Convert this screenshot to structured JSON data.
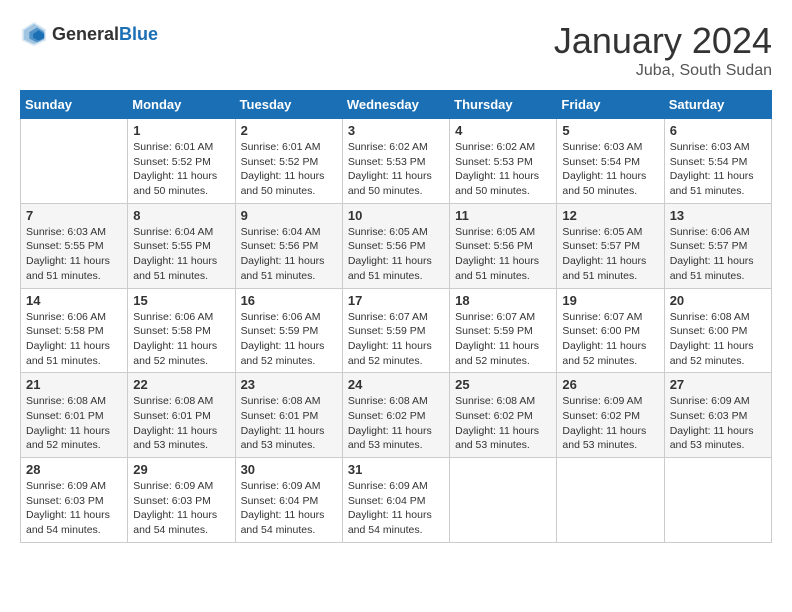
{
  "header": {
    "logo_general": "General",
    "logo_blue": "Blue",
    "month_title": "January 2024",
    "location": "Juba, South Sudan"
  },
  "days_of_week": [
    "Sunday",
    "Monday",
    "Tuesday",
    "Wednesday",
    "Thursday",
    "Friday",
    "Saturday"
  ],
  "weeks": [
    [
      {
        "day": "",
        "sunrise": "",
        "sunset": "",
        "daylight": ""
      },
      {
        "day": "1",
        "sunrise": "Sunrise: 6:01 AM",
        "sunset": "Sunset: 5:52 PM",
        "daylight": "Daylight: 11 hours and 50 minutes."
      },
      {
        "day": "2",
        "sunrise": "Sunrise: 6:01 AM",
        "sunset": "Sunset: 5:52 PM",
        "daylight": "Daylight: 11 hours and 50 minutes."
      },
      {
        "day": "3",
        "sunrise": "Sunrise: 6:02 AM",
        "sunset": "Sunset: 5:53 PM",
        "daylight": "Daylight: 11 hours and 50 minutes."
      },
      {
        "day": "4",
        "sunrise": "Sunrise: 6:02 AM",
        "sunset": "Sunset: 5:53 PM",
        "daylight": "Daylight: 11 hours and 50 minutes."
      },
      {
        "day": "5",
        "sunrise": "Sunrise: 6:03 AM",
        "sunset": "Sunset: 5:54 PM",
        "daylight": "Daylight: 11 hours and 50 minutes."
      },
      {
        "day": "6",
        "sunrise": "Sunrise: 6:03 AM",
        "sunset": "Sunset: 5:54 PM",
        "daylight": "Daylight: 11 hours and 51 minutes."
      }
    ],
    [
      {
        "day": "7",
        "sunrise": "Sunrise: 6:03 AM",
        "sunset": "Sunset: 5:55 PM",
        "daylight": "Daylight: 11 hours and 51 minutes."
      },
      {
        "day": "8",
        "sunrise": "Sunrise: 6:04 AM",
        "sunset": "Sunset: 5:55 PM",
        "daylight": "Daylight: 11 hours and 51 minutes."
      },
      {
        "day": "9",
        "sunrise": "Sunrise: 6:04 AM",
        "sunset": "Sunset: 5:56 PM",
        "daylight": "Daylight: 11 hours and 51 minutes."
      },
      {
        "day": "10",
        "sunrise": "Sunrise: 6:05 AM",
        "sunset": "Sunset: 5:56 PM",
        "daylight": "Daylight: 11 hours and 51 minutes."
      },
      {
        "day": "11",
        "sunrise": "Sunrise: 6:05 AM",
        "sunset": "Sunset: 5:56 PM",
        "daylight": "Daylight: 11 hours and 51 minutes."
      },
      {
        "day": "12",
        "sunrise": "Sunrise: 6:05 AM",
        "sunset": "Sunset: 5:57 PM",
        "daylight": "Daylight: 11 hours and 51 minutes."
      },
      {
        "day": "13",
        "sunrise": "Sunrise: 6:06 AM",
        "sunset": "Sunset: 5:57 PM",
        "daylight": "Daylight: 11 hours and 51 minutes."
      }
    ],
    [
      {
        "day": "14",
        "sunrise": "Sunrise: 6:06 AM",
        "sunset": "Sunset: 5:58 PM",
        "daylight": "Daylight: 11 hours and 51 minutes."
      },
      {
        "day": "15",
        "sunrise": "Sunrise: 6:06 AM",
        "sunset": "Sunset: 5:58 PM",
        "daylight": "Daylight: 11 hours and 52 minutes."
      },
      {
        "day": "16",
        "sunrise": "Sunrise: 6:06 AM",
        "sunset": "Sunset: 5:59 PM",
        "daylight": "Daylight: 11 hours and 52 minutes."
      },
      {
        "day": "17",
        "sunrise": "Sunrise: 6:07 AM",
        "sunset": "Sunset: 5:59 PM",
        "daylight": "Daylight: 11 hours and 52 minutes."
      },
      {
        "day": "18",
        "sunrise": "Sunrise: 6:07 AM",
        "sunset": "Sunset: 5:59 PM",
        "daylight": "Daylight: 11 hours and 52 minutes."
      },
      {
        "day": "19",
        "sunrise": "Sunrise: 6:07 AM",
        "sunset": "Sunset: 6:00 PM",
        "daylight": "Daylight: 11 hours and 52 minutes."
      },
      {
        "day": "20",
        "sunrise": "Sunrise: 6:08 AM",
        "sunset": "Sunset: 6:00 PM",
        "daylight": "Daylight: 11 hours and 52 minutes."
      }
    ],
    [
      {
        "day": "21",
        "sunrise": "Sunrise: 6:08 AM",
        "sunset": "Sunset: 6:01 PM",
        "daylight": "Daylight: 11 hours and 52 minutes."
      },
      {
        "day": "22",
        "sunrise": "Sunrise: 6:08 AM",
        "sunset": "Sunset: 6:01 PM",
        "daylight": "Daylight: 11 hours and 53 minutes."
      },
      {
        "day": "23",
        "sunrise": "Sunrise: 6:08 AM",
        "sunset": "Sunset: 6:01 PM",
        "daylight": "Daylight: 11 hours and 53 minutes."
      },
      {
        "day": "24",
        "sunrise": "Sunrise: 6:08 AM",
        "sunset": "Sunset: 6:02 PM",
        "daylight": "Daylight: 11 hours and 53 minutes."
      },
      {
        "day": "25",
        "sunrise": "Sunrise: 6:08 AM",
        "sunset": "Sunset: 6:02 PM",
        "daylight": "Daylight: 11 hours and 53 minutes."
      },
      {
        "day": "26",
        "sunrise": "Sunrise: 6:09 AM",
        "sunset": "Sunset: 6:02 PM",
        "daylight": "Daylight: 11 hours and 53 minutes."
      },
      {
        "day": "27",
        "sunrise": "Sunrise: 6:09 AM",
        "sunset": "Sunset: 6:03 PM",
        "daylight": "Daylight: 11 hours and 53 minutes."
      }
    ],
    [
      {
        "day": "28",
        "sunrise": "Sunrise: 6:09 AM",
        "sunset": "Sunset: 6:03 PM",
        "daylight": "Daylight: 11 hours and 54 minutes."
      },
      {
        "day": "29",
        "sunrise": "Sunrise: 6:09 AM",
        "sunset": "Sunset: 6:03 PM",
        "daylight": "Daylight: 11 hours and 54 minutes."
      },
      {
        "day": "30",
        "sunrise": "Sunrise: 6:09 AM",
        "sunset": "Sunset: 6:04 PM",
        "daylight": "Daylight: 11 hours and 54 minutes."
      },
      {
        "day": "31",
        "sunrise": "Sunrise: 6:09 AM",
        "sunset": "Sunset: 6:04 PM",
        "daylight": "Daylight: 11 hours and 54 minutes."
      },
      {
        "day": "",
        "sunrise": "",
        "sunset": "",
        "daylight": ""
      },
      {
        "day": "",
        "sunrise": "",
        "sunset": "",
        "daylight": ""
      },
      {
        "day": "",
        "sunrise": "",
        "sunset": "",
        "daylight": ""
      }
    ]
  ]
}
